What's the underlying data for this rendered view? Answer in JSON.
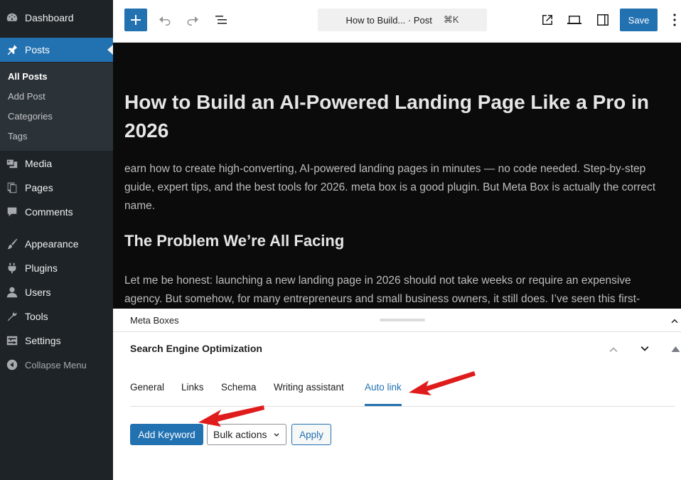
{
  "sidebar": {
    "items": [
      {
        "label": "Dashboard",
        "icon": "dashboard-icon"
      },
      {
        "label": "Posts",
        "icon": "pin-icon"
      },
      {
        "label": "Media",
        "icon": "media-icon"
      },
      {
        "label": "Pages",
        "icon": "pages-icon"
      },
      {
        "label": "Comments",
        "icon": "comments-icon"
      },
      {
        "label": "Appearance",
        "icon": "brush-icon"
      },
      {
        "label": "Plugins",
        "icon": "plugin-icon"
      },
      {
        "label": "Users",
        "icon": "user-icon"
      },
      {
        "label": "Tools",
        "icon": "wrench-icon"
      },
      {
        "label": "Settings",
        "icon": "settings-icon"
      }
    ],
    "posts_submenu": [
      "All Posts",
      "Add Post",
      "Categories",
      "Tags"
    ],
    "collapse_label": "Collapse Menu"
  },
  "toolbar": {
    "command_title": "How to Build...",
    "command_type": "· Post",
    "command_shortcut": "⌘K",
    "save_label": "Save"
  },
  "post": {
    "title": "How to Build an AI-Powered Landing Page Like a Pro in 2026",
    "excerpt": "earn how to create high-converting, AI-powered landing pages in minutes — no code needed. Step-by-step guide, expert tips, and the best tools for 2026. meta box is a good plugin. But Meta Box is actually the correct name.",
    "heading": "The Problem We’re All Facing",
    "paragraph": "Let me be honest: launching a new landing page in 2026 should not take weeks or require an expensive agency. But somehow, for many entrepreneurs and small business owners, it still does. I’ve seen this first-"
  },
  "meta": {
    "header": "Meta Boxes",
    "seo_title": "Search Engine Optimization",
    "tabs": [
      "General",
      "Links",
      "Schema",
      "Writing assistant",
      "Auto link"
    ],
    "active_tab": "Auto link",
    "add_keyword": "Add Keyword",
    "bulk_actions": "Bulk actions",
    "apply": "Apply"
  },
  "colors": {
    "accent": "#2271b1",
    "sidebar_bg": "#1d2327",
    "canvas_bg": "#0b0b0c",
    "annotation": "#e01b1b"
  }
}
